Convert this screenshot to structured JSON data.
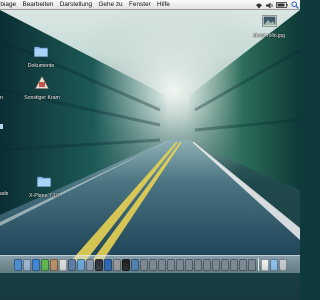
{
  "menubar": {
    "items": [
      {
        "label": "ibiage"
      },
      {
        "label": "Bearbeiten"
      },
      {
        "label": "Darstellung"
      },
      {
        "label": "Gehe zu"
      },
      {
        "label": "Fenster"
      },
      {
        "label": "Hilfe"
      }
    ],
    "status_icons": [
      "wifi-icon",
      "volume-icon",
      "battery-icon",
      "search-icon"
    ]
  },
  "desktop": {
    "icons": [
      {
        "label": "Dokumente",
        "icon": "folder-icon"
      },
      {
        "label": "Sonstiger Kram",
        "icon": "application-icon"
      },
      {
        "label": "X-Plane 7.10",
        "icon": "folder-icon"
      },
      {
        "label": "xhost rollo.jpg",
        "icon": "image-file-icon"
      },
      {
        "label": "n"
      },
      {
        "label": "ads"
      }
    ]
  },
  "dock": {
    "icons": [
      "finder-icon",
      "mail-icon",
      "safari-icon",
      "ichat-icon",
      "addressbook-icon",
      "ical-icon",
      "iphoto-icon",
      "itunes-icon",
      "imovie-icon",
      "idvd-icon",
      "quicktime-icon",
      "preferences-icon",
      "terminal-icon",
      "xplane-icon",
      "app-icon",
      "app-icon",
      "app-icon",
      "app-icon",
      "app-icon",
      "app-icon",
      "app-icon",
      "app-icon",
      "app-icon",
      "app-icon",
      "app-icon",
      "app-icon",
      "app-icon",
      "document-icon",
      "folder-icon",
      "trash-icon"
    ]
  },
  "colors": {
    "menubar": "#eeeeee",
    "road_line": "#e8d253",
    "foliage": "#214a4c"
  }
}
